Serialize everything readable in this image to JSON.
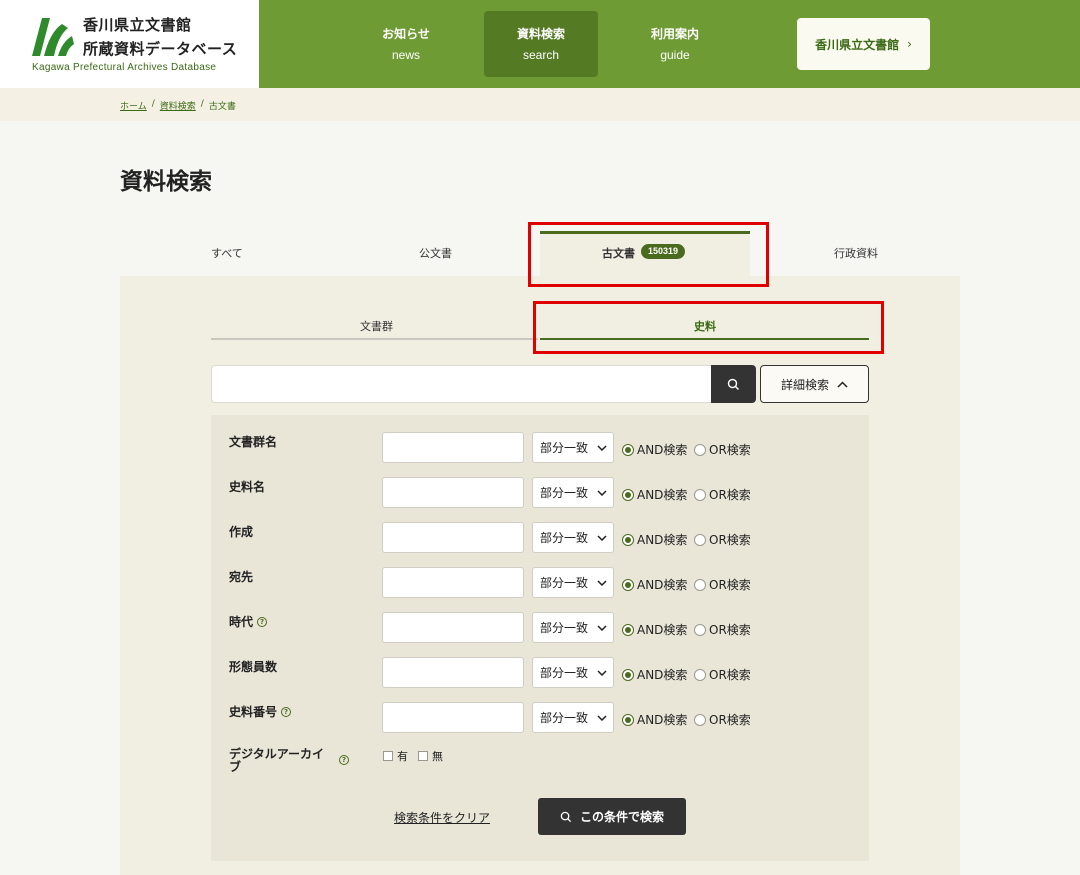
{
  "header": {
    "logo_line1": "香川県立文書館",
    "logo_line2": "所蔵資料データベース",
    "logo_sub": "Kagawa Prefectural Archives Database",
    "nav": [
      {
        "jp": "お知らせ",
        "en": "news"
      },
      {
        "jp": "資料検索",
        "en": "search"
      },
      {
        "jp": "利用案内",
        "en": "guide"
      }
    ],
    "archive_button": "香川県立文書館",
    "colors": {
      "brand_green": "#6e9b33",
      "dark_green": "#4a6b1d"
    }
  },
  "breadcrumb": [
    "ホーム",
    "資料検索",
    "古文書"
  ],
  "page_title": "資料検索",
  "category_tabs": [
    "すべて",
    "公文書",
    "古文書",
    "行政資料"
  ],
  "active_category_count": "150319",
  "sub_tabs": [
    "文書群",
    "史料"
  ],
  "search": {
    "placeholder": "",
    "advanced_label": "詳細検索"
  },
  "fields": [
    {
      "label": "文書群名",
      "match": "部分一致"
    },
    {
      "label": "史料名",
      "match": "部分一致"
    },
    {
      "label": "作成",
      "match": "部分一致"
    },
    {
      "label": "宛先",
      "match": "部分一致"
    },
    {
      "label": "時代",
      "match": "部分一致"
    },
    {
      "label": "形態員数",
      "match": "部分一致"
    },
    {
      "label": "史料番号",
      "match": "部分一致"
    }
  ],
  "radio_and": "AND検索",
  "radio_or": "OR検索",
  "digital_archive": {
    "label": "デジタルアーカイブ",
    "option_yes": "有",
    "option_no": "無"
  },
  "actions": {
    "clear": "検索条件をクリア",
    "submit": "この条件で検索"
  }
}
